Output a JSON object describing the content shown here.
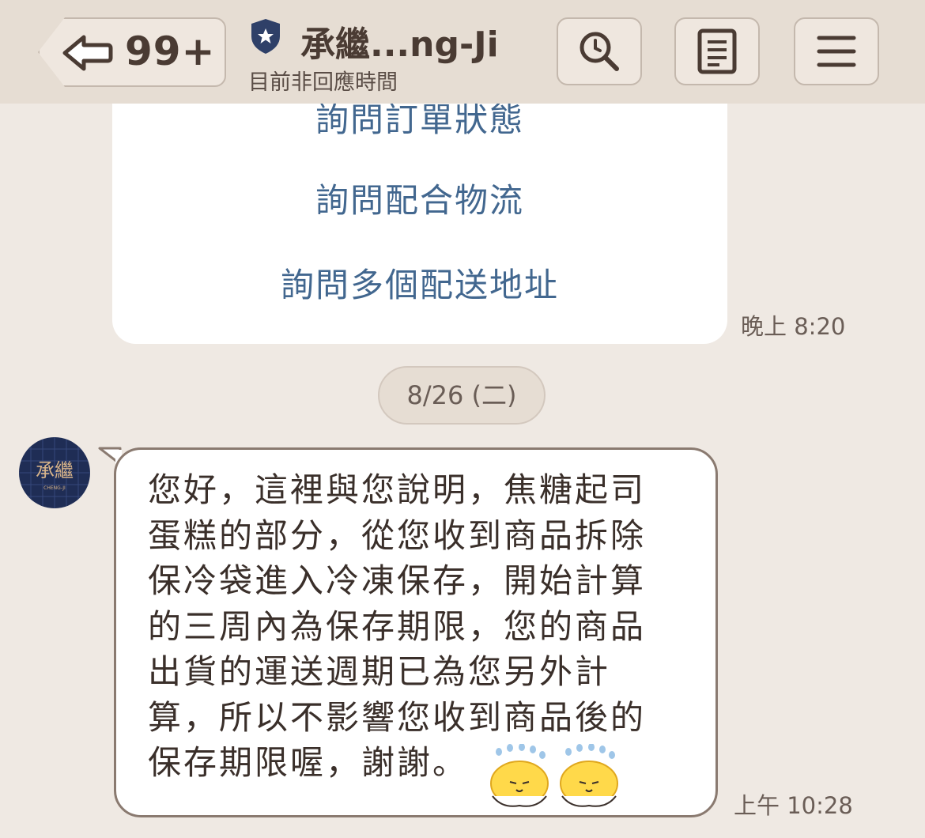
{
  "header": {
    "back_count": "99+",
    "chat_title": "承繼...ng-Ji",
    "status": "目前非回應時間"
  },
  "icons": [
    "back-arrow-icon",
    "shield-star-icon",
    "search-icon",
    "notes-icon",
    "menu-icon",
    "smiley-sweat-icon"
  ],
  "previous_card": {
    "options": [
      "詢問訂單狀態",
      "詢問配合物流",
      "詢問多個配送地址"
    ],
    "time": "晚上 8:20"
  },
  "date_divider": "8/26 (二)",
  "message": {
    "avatar_text": "承繼",
    "avatar_sub": "CHENG-JI",
    "lines": [
      "您好，這裡與您說明，焦糖起司",
      "蛋糕的部分，從您收到商品拆除",
      "保冷袋進入冷凍保存，開始計算",
      "的三周內為保存期限，您的商品",
      "出貨的運送週期已為您另外計",
      "算，所以不影響您收到商品後的",
      "保存期限喔，謝謝。"
    ],
    "time": "上午 10:28"
  },
  "colors": {
    "background": "#efe9e3",
    "header": "#e6ddd3",
    "link": "#42678f",
    "avatar_bg": "#1f2d55",
    "bubble_border": "#8a7a70"
  }
}
